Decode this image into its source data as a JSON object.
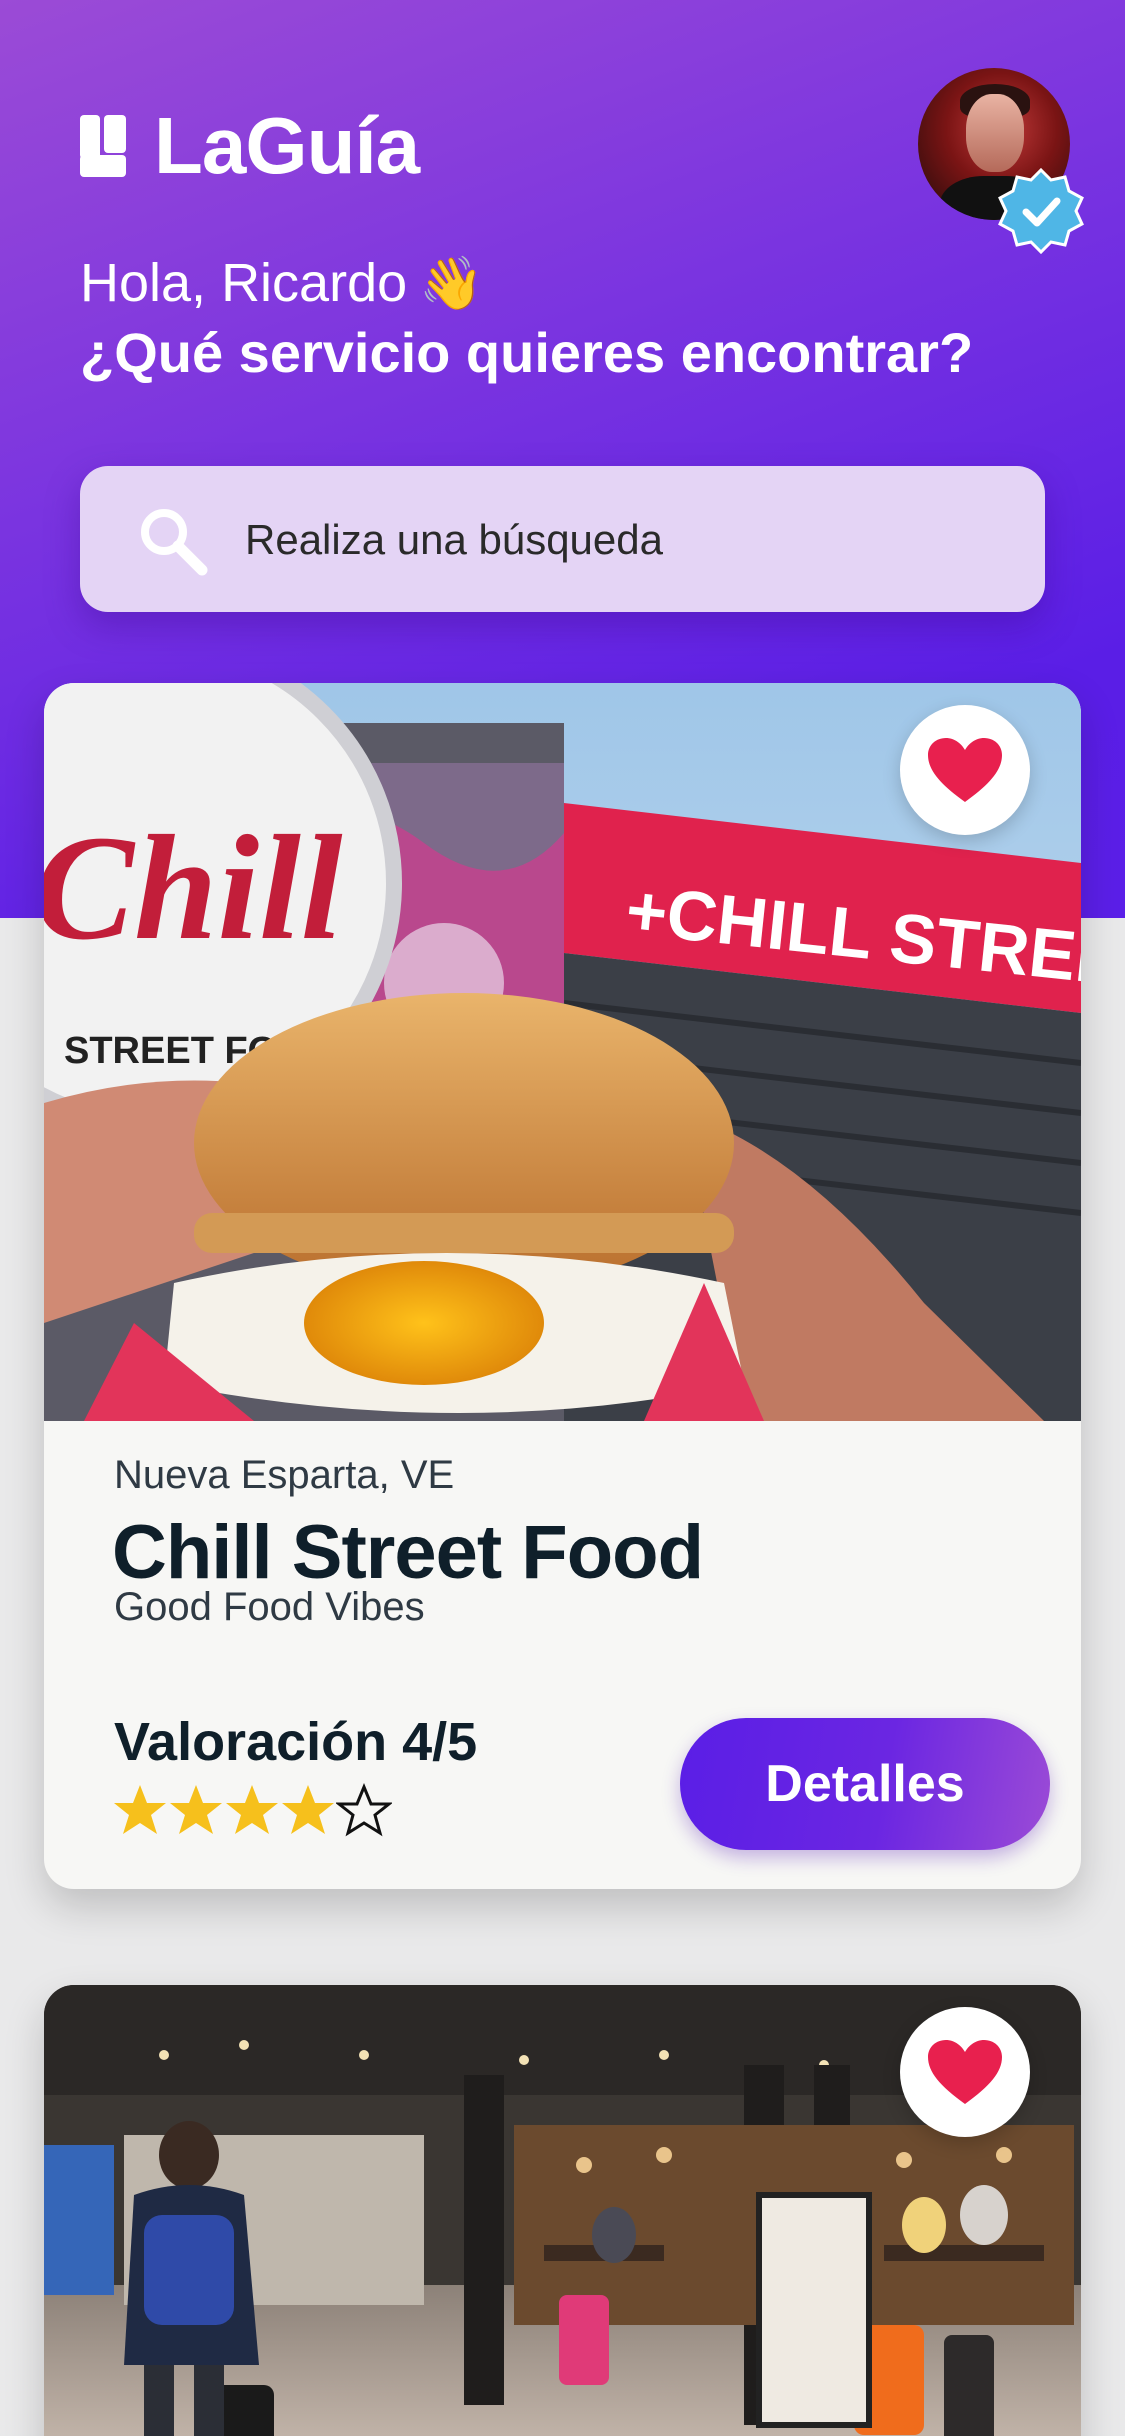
{
  "app": {
    "name": "LaGuía"
  },
  "user": {
    "greeting": "Hola, Ricardo",
    "wave_emoji": "👋",
    "verified": true
  },
  "prompt": "¿Qué servicio quieres encontrar?",
  "search": {
    "placeholder": "Realiza una búsqueda"
  },
  "colors": {
    "brand_purple": "#6b26e2",
    "star_yellow": "#f6c01c",
    "heart_red": "#e8204e",
    "verified_blue": "#4fb6e6"
  },
  "listings": [
    {
      "location": "Nueva Esparta, VE",
      "name": "Chill Street Food",
      "tagline": "Good Food Vibes",
      "rating_label": "Valoración 4/5",
      "rating": 4,
      "rating_max": 5,
      "favorited": true,
      "details_label": "Detalles",
      "image": {
        "sign_text": "+CHILL STREET FOOD",
        "logo_text": "Chill",
        "logo_sub": "STREET FOOD"
      }
    },
    {
      "favorited": true
    }
  ]
}
